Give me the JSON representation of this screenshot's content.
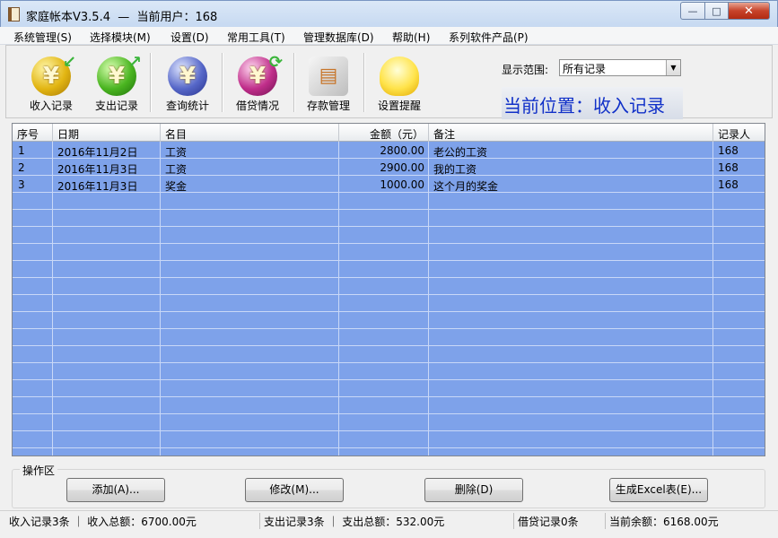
{
  "window": {
    "title": "家庭帐本V3.5.4  —  当前用户：168",
    "min_glyph": "—",
    "max_glyph": "□",
    "close_glyph": "✕"
  },
  "menu": [
    "系统管理(S)",
    "选择模块(M)",
    "设置(D)",
    "常用工具(T)",
    "管理数据库(D)",
    "帮助(H)",
    "系列软件产品(P)"
  ],
  "toolbar": {
    "tools": [
      {
        "label": "收入记录",
        "icon": "income-yen-icon",
        "glyph": "¥"
      },
      {
        "label": "支出记录",
        "icon": "expense-yen-icon",
        "glyph": "¥"
      },
      {
        "label": "查询统计",
        "icon": "query-stats-icon",
        "glyph": "¥"
      },
      {
        "label": "借贷情况",
        "icon": "loan-yen-icon",
        "glyph": "¥"
      },
      {
        "label": "存款管理",
        "icon": "bank-card-icon",
        "glyph": "▤"
      },
      {
        "label": "设置提醒",
        "icon": "lightbulb-icon",
        "glyph": ""
      }
    ],
    "range_label": "显示范围:",
    "range_value": "所有记录",
    "location": "当前位置：收入记录"
  },
  "table": {
    "columns": [
      "序号",
      "日期",
      "名目",
      "金额（元）",
      "备注",
      "记录人"
    ],
    "rows": [
      [
        "1",
        "2016年11月2日",
        "工资",
        "2800.00",
        "老公的工资",
        "168"
      ],
      [
        "2",
        "2016年11月3日",
        "工资",
        "2900.00",
        "我的工资",
        "168"
      ],
      [
        "3",
        "2016年11月3日",
        "奖金",
        "1000.00",
        "这个月的奖金",
        "168"
      ]
    ]
  },
  "ops": {
    "title": "操作区",
    "add": "添加(A)...",
    "edit": "修改(M)...",
    "delete": "删除(D)",
    "excel": "生成Excel表(E)..."
  },
  "status": {
    "income": "收入记录3条 ｜ 收入总额：6700.00元",
    "expense": "支出记录3条 ｜ 支出总额：532.00元",
    "loans": "借贷记录0条",
    "balance": "当前余额：6168.00元"
  },
  "colors": {
    "grid_bg": "#7ea2ea",
    "location_text": "#1030c8"
  }
}
